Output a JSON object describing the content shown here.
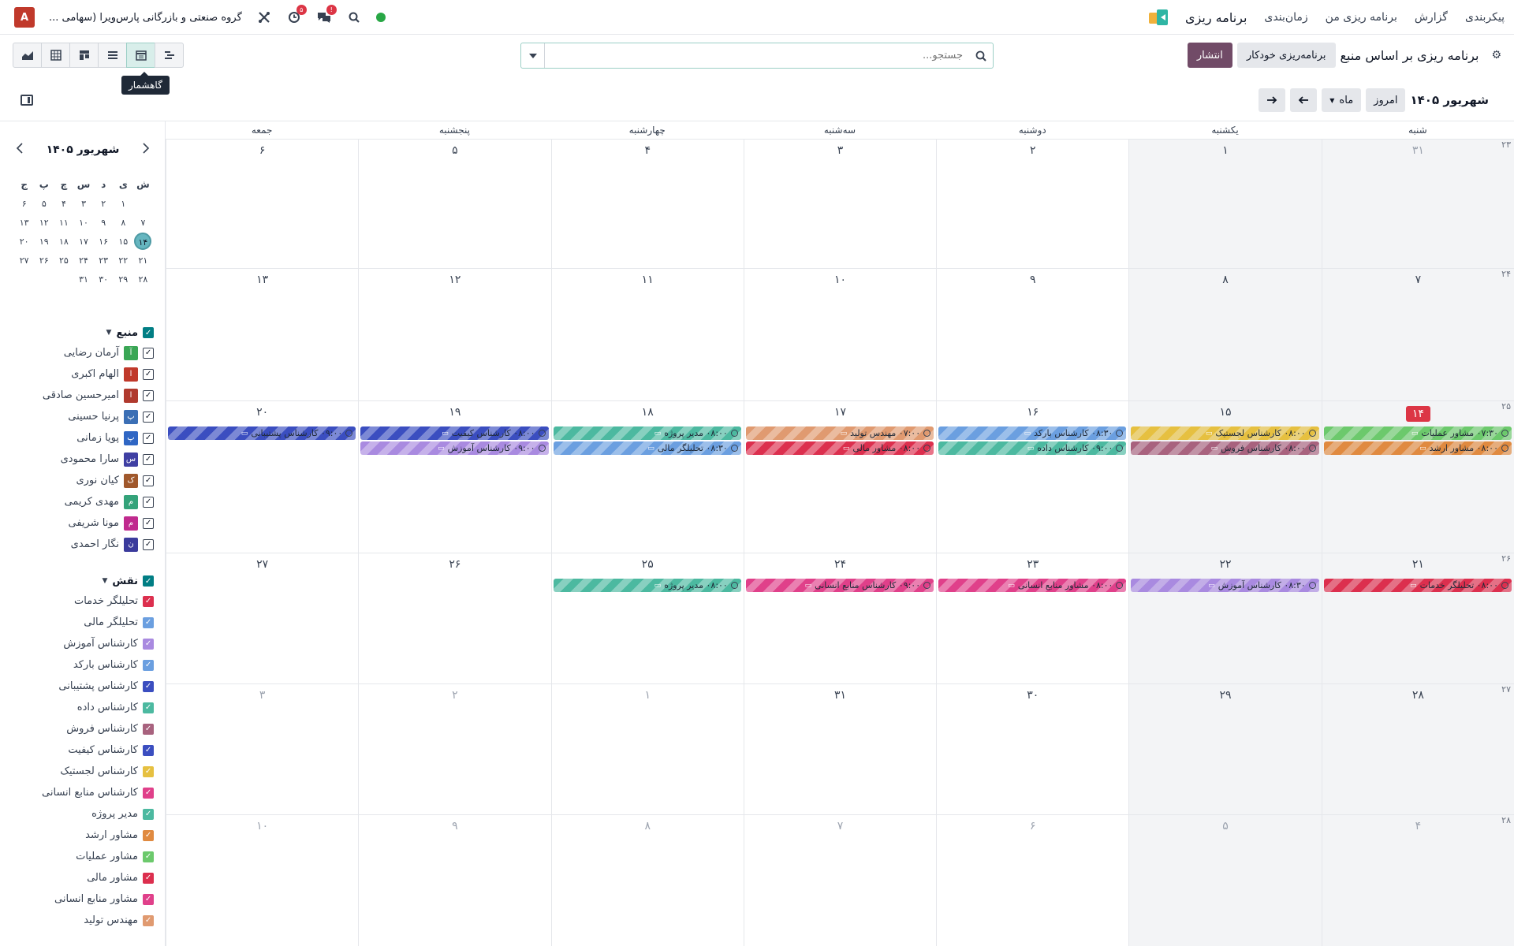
{
  "topnav": {
    "app_name": "برنامه ریزی",
    "menu": [
      "زمان‌بندی",
      "برنامه ریزی من",
      "گزارش",
      "پیکربندی"
    ],
    "company": "گروه صنعتی و بازرگانی پارس‌ویرا (سهامی ...",
    "user_initial": "A",
    "activity_badge": "۵",
    "chat_badge": "!"
  },
  "controls": {
    "publish_label": "انتشار",
    "auto_plan_label": "برنامه‌ریزی خودکار",
    "view_title": "برنامه ریزی بر اساس منبع",
    "search_placeholder": "جستجو...",
    "tooltip": "گاهشمار"
  },
  "calendar_header": {
    "period_label": "ماه",
    "today_label": "امروز",
    "title": "شهریور ۱۴۰۵"
  },
  "mini_calendar": {
    "title": "شهریور ۱۴۰۵",
    "weekdays": [
      "ش",
      "ی",
      "د",
      "س",
      "چ",
      "پ",
      "ج"
    ],
    "weeks": [
      [
        "",
        "۱",
        "۲",
        "۳",
        "۴",
        "۵",
        "۶"
      ],
      [
        "۷",
        "۸",
        "۹",
        "۱۰",
        "۱۱",
        "۱۲",
        "۱۳"
      ],
      [
        "۱۴",
        "۱۵",
        "۱۶",
        "۱۷",
        "۱۸",
        "۱۹",
        "۲۰"
      ],
      [
        "۲۱",
        "۲۲",
        "۲۳",
        "۲۴",
        "۲۵",
        "۲۶",
        "۲۷"
      ],
      [
        "۲۸",
        "۲۹",
        "۳۰",
        "۳۱",
        "",
        "",
        ""
      ]
    ],
    "today": "۱۴"
  },
  "filters": {
    "resource_title": "منبع",
    "resources": [
      {
        "name": "آرمان رضایی",
        "initial": "آ",
        "color": "#3aa655"
      },
      {
        "name": "الهام اکبری",
        "initial": "ا",
        "color": "#c0392b"
      },
      {
        "name": "امیرحسین صادقی",
        "initial": "ا",
        "color": "#b03a2e"
      },
      {
        "name": "پرنیا حسینی",
        "initial": "پ",
        "color": "#3b6fb5"
      },
      {
        "name": "پویا زمانی",
        "initial": "پ",
        "color": "#2f66c4"
      },
      {
        "name": "سارا محمودی",
        "initial": "س",
        "color": "#3f3fa3"
      },
      {
        "name": "کیان نوری",
        "initial": "ک",
        "color": "#a0582c"
      },
      {
        "name": "مهدی کریمی",
        "initial": "م",
        "color": "#34a37a"
      },
      {
        "name": "مونا شریفی",
        "initial": "م",
        "color": "#c02a8e"
      },
      {
        "name": "نگار احمدی",
        "initial": "ن",
        "color": "#3b3b9c"
      }
    ],
    "role_title": "نقش",
    "roles": [
      {
        "name": "تحلیلگر خدمات",
        "color": "#dc2f4e"
      },
      {
        "name": "تحلیلگر مالی",
        "color": "#6b9fe0"
      },
      {
        "name": "کارشناس آموزش",
        "color": "#a98ae0"
      },
      {
        "name": "کارشناس بارکد",
        "color": "#6b9fe0"
      },
      {
        "name": "کارشناس پشتیبانی",
        "color": "#3b4ec0"
      },
      {
        "name": "کارشناس داده",
        "color": "#4cb9a0"
      },
      {
        "name": "کارشناس فروش",
        "color": "#a8627e"
      },
      {
        "name": "کارشناس کیفیت",
        "color": "#3b4ec0"
      },
      {
        "name": "کارشناس لجستیک",
        "color": "#e6c040"
      },
      {
        "name": "کارشناس منابع انسانی",
        "color": "#e0408a"
      },
      {
        "name": "مدیر پروژه",
        "color": "#4cb9a0"
      },
      {
        "name": "مشاور ارشد",
        "color": "#e08a40"
      },
      {
        "name": "مشاور عملیات",
        "color": "#6cc96c"
      },
      {
        "name": "مشاور مالی",
        "color": "#dc2f4e"
      },
      {
        "name": "مشاور منابع انسانی",
        "color": "#e0408a"
      },
      {
        "name": "مهندس تولید",
        "color": "#e09a70"
      }
    ]
  },
  "calendar": {
    "weekdays": [
      "شنبه",
      "یکشنبه",
      "دوشنبه",
      "سه‌شنبه",
      "چهارشنبه",
      "پنجشنبه",
      "جمعه"
    ],
    "weeks": [
      {
        "num": "۲۳",
        "days": [
          {
            "d": "۳۱",
            "m": true
          },
          {
            "d": "۱"
          },
          {
            "d": "۲"
          },
          {
            "d": "۳"
          },
          {
            "d": "۴"
          },
          {
            "d": "۵"
          },
          {
            "d": "۶"
          }
        ],
        "events": []
      },
      {
        "num": "۲۴",
        "days": [
          {
            "d": "۷"
          },
          {
            "d": "۸"
          },
          {
            "d": "۹"
          },
          {
            "d": "۱۰"
          },
          {
            "d": "۱۱"
          },
          {
            "d": "۱۲"
          },
          {
            "d": "۱۳"
          }
        ],
        "events": []
      },
      {
        "num": "۲۵",
        "days": [
          {
            "d": "۱۴",
            "t": true
          },
          {
            "d": "۱۵"
          },
          {
            "d": "۱۶"
          },
          {
            "d": "۱۷"
          },
          {
            "d": "۱۸"
          },
          {
            "d": "۱۹"
          },
          {
            "d": "۲۰"
          }
        ],
        "events": [
          {
            "col": 0,
            "row": 0,
            "text": "۰۷:۳۰ مشاور عملیات",
            "color": "#6cc96c"
          },
          {
            "col": 0,
            "row": 1,
            "text": "۰۸:۰۰ مشاور ارشد",
            "color": "#e08a40"
          },
          {
            "col": 1,
            "row": 0,
            "text": "۰۸:۰۰ کارشناس لجستیک",
            "color": "#e6c040"
          },
          {
            "col": 1,
            "row": 1,
            "text": "۰۸:۰۰ کارشناس فروش",
            "color": "#a8627e"
          },
          {
            "col": 2,
            "row": 0,
            "text": "۰۸:۳۰ کارشناس بارکد",
            "color": "#6b9fe0"
          },
          {
            "col": 2,
            "row": 1,
            "text": "۰۹:۰۰ کارشناس داده",
            "color": "#4cb9a0"
          },
          {
            "col": 3,
            "row": 0,
            "text": "۰۷:۰۰ مهندس تولید",
            "color": "#e09a70"
          },
          {
            "col": 3,
            "row": 1,
            "text": "۰۸:۰۰ مشاور مالی",
            "color": "#dc2f4e"
          },
          {
            "col": 4,
            "row": 0,
            "text": "۰۸:۰۰ مدیر پروژه",
            "color": "#4cb9a0"
          },
          {
            "col": 4,
            "row": 1,
            "text": "۰۸:۳۰ تحلیلگر مالی",
            "color": "#6b9fe0"
          },
          {
            "col": 5,
            "row": 0,
            "text": "۰۸:۰۰ کارشناس کیفیت",
            "color": "#3b4ec0"
          },
          {
            "col": 5,
            "row": 1,
            "text": "۰۹:۰۰ کارشناس آموزش",
            "color": "#a98ae0"
          },
          {
            "col": 6,
            "row": 0,
            "text": "۰۹:۰۰ کارشناس پشتیبانی",
            "color": "#3b4ec0"
          }
        ]
      },
      {
        "num": "۲۶",
        "days": [
          {
            "d": "۲۱"
          },
          {
            "d": "۲۲"
          },
          {
            "d": "۲۳"
          },
          {
            "d": "۲۴"
          },
          {
            "d": "۲۵"
          },
          {
            "d": "۲۶"
          },
          {
            "d": "۲۷"
          }
        ],
        "events": [
          {
            "col": 0,
            "row": 0,
            "text": "۰۸:۰۰ تحلیلگر خدمات",
            "color": "#dc2f4e"
          },
          {
            "col": 1,
            "row": 0,
            "text": "۰۸:۳۰ کارشناس آموزش",
            "color": "#a98ae0"
          },
          {
            "col": 2,
            "row": 0,
            "text": "۰۸:۰۰ مشاور منابع انسانی",
            "color": "#e0408a"
          },
          {
            "col": 3,
            "row": 0,
            "text": "۰۹:۰۰ کارشناس منابع انسانی",
            "color": "#e0408a"
          },
          {
            "col": 4,
            "row": 0,
            "text": "۰۸:۰۰ مدیر پروژه",
            "color": "#4cb9a0"
          }
        ]
      },
      {
        "num": "۲۷",
        "days": [
          {
            "d": "۲۸"
          },
          {
            "d": "۲۹"
          },
          {
            "d": "۳۰"
          },
          {
            "d": "۳۱"
          },
          {
            "d": "۱",
            "m": true
          },
          {
            "d": "۲",
            "m": true
          },
          {
            "d": "۳",
            "m": true
          }
        ],
        "events": []
      },
      {
        "num": "۲۸",
        "days": [
          {
            "d": "۴",
            "m": true
          },
          {
            "d": "۵",
            "m": true
          },
          {
            "d": "۶",
            "m": true
          },
          {
            "d": "۷",
            "m": true
          },
          {
            "d": "۸",
            "m": true
          },
          {
            "d": "۹",
            "m": true
          },
          {
            "d": "۱۰",
            "m": true
          }
        ],
        "events": []
      }
    ]
  }
}
